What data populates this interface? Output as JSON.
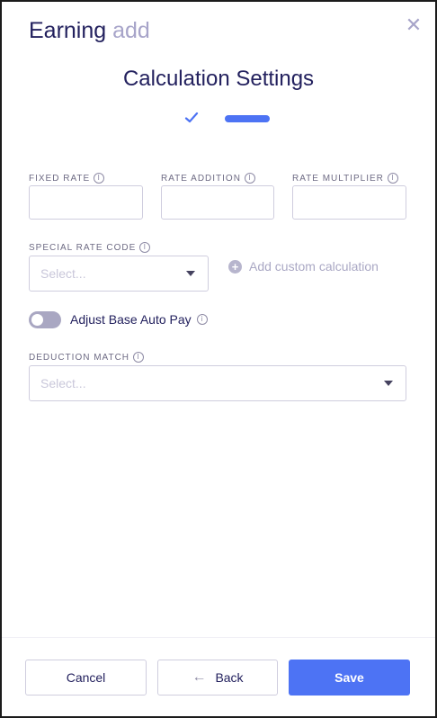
{
  "header": {
    "title": "Earning",
    "subtitle": "add",
    "close_icon": "close-icon"
  },
  "page": {
    "heading": "Calculation Settings"
  },
  "steps": {
    "completed_icon": "check-icon",
    "active_step": 2
  },
  "fields": {
    "fixed_rate": {
      "label": "FIXED RATE",
      "value": ""
    },
    "rate_addition": {
      "label": "RATE ADDITION",
      "value": ""
    },
    "rate_multiplier": {
      "label": "RATE MULTIPLIER",
      "value": ""
    },
    "special_rate_code": {
      "label": "SPECIAL RATE CODE",
      "placeholder": "Select..."
    },
    "deduction_match": {
      "label": "DEDUCTION MATCH",
      "placeholder": "Select..."
    }
  },
  "add_custom": {
    "label": "Add custom calculation"
  },
  "toggle": {
    "label": "Adjust Base Auto Pay",
    "on": false
  },
  "footer": {
    "cancel": "Cancel",
    "back": "Back",
    "save": "Save"
  },
  "colors": {
    "primary": "#4d73f4",
    "title": "#23215e",
    "muted": "#a7a4c9"
  }
}
